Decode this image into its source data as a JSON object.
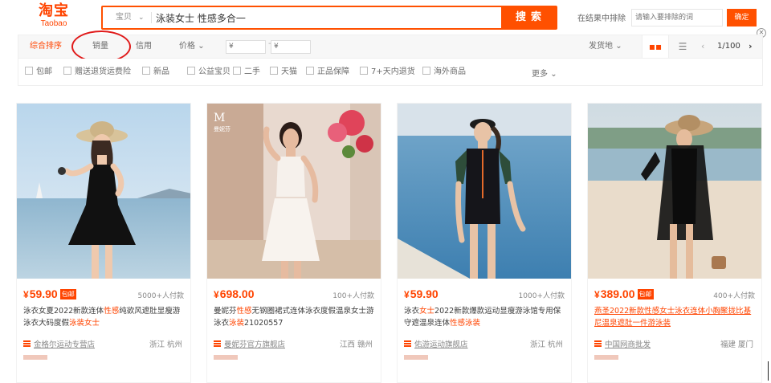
{
  "header": {
    "logo_cn": "淘宝",
    "logo_en": "Taobao",
    "search_scope": "宝贝",
    "search_query": "泳装女士 性感多合一",
    "search_button": "搜索",
    "exclude_label": "在结果中排除",
    "exclude_placeholder": "请输入要排除的词",
    "exclude_button": "确定"
  },
  "sortbar": {
    "default_sort": "综合排序",
    "sales_sort": "销量",
    "credit_sort": "信用",
    "price_sort": "价格",
    "price_min": "¥",
    "price_max": "¥",
    "ship_from": "发货地",
    "page": "1/100"
  },
  "filters": [
    "包邮",
    "赠送退货运费险",
    "新品",
    "公益宝贝",
    "二手",
    "天猫",
    "正品保障",
    "7+天内退货",
    "海外商品"
  ],
  "more_label": "更多",
  "products": [
    {
      "price": "59.90",
      "badge": "包邮",
      "sold": "5000+人付款",
      "title_a": "泳衣女夏2022新款连体",
      "title_hl1": "性感",
      "title_b": "纯欲风遮肚显瘦游泳衣大码度假",
      "title_hl2": "泳装女士",
      "shop": "金格尔运动专营店",
      "location": "浙江 杭州"
    },
    {
      "price": "698.00",
      "badge": "",
      "sold": "100+人付款",
      "title_a": "曼妮芬",
      "title_hl1": "性感",
      "title_b": "无钢圈裙式连体泳衣度假温泉女士游泳衣",
      "title_hl2": "泳装",
      "title_c": "21020557",
      "shop": "曼妮芬官方旗舰店",
      "location": "江西 赣州"
    },
    {
      "price": "59.90",
      "badge": "",
      "sold": "1000+人付款",
      "title_a": "泳衣",
      "title_hl1": "女士",
      "title_b": "2022新款爆款运动显瘦游泳馆专用保守遮温泉连体",
      "title_hl2": "性感泳装",
      "shop": "佑游运动旗舰店",
      "location": "浙江 杭州"
    },
    {
      "price": "389.00",
      "badge": "包邮",
      "sold": "400+人付款",
      "title_linked": "燕圣2022新款性感女士泳衣连体小胸聚拢比基尼温泉遮肚一件游泳装",
      "shop": "中国网商批发",
      "location": "福建 厦门"
    }
  ],
  "colors": {
    "accent": "#ff4400",
    "search_border": "#ff5000",
    "annotation": "#e01a1a"
  },
  "icons": {
    "close": "close-icon",
    "grid": "grid-view-icon",
    "list": "list-view-icon",
    "shop": "shop-icon"
  }
}
